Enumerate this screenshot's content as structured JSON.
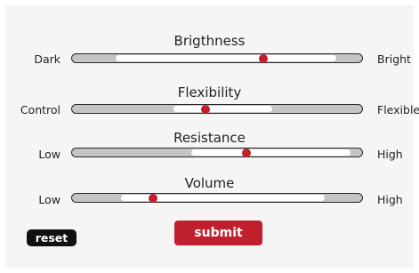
{
  "sliders": [
    {
      "title": "Brigthness",
      "left": "Dark",
      "right": "Bright",
      "range": [
        0.15,
        0.91
      ],
      "value": 0.66
    },
    {
      "title": "Flexibility",
      "left": "Control",
      "right": "Flexible",
      "range": [
        0.35,
        0.69
      ],
      "value": 0.46
    },
    {
      "title": "Resistance",
      "left": "Low",
      "right": "High",
      "range": [
        0.41,
        0.96
      ],
      "value": 0.6
    },
    {
      "title": "Volume",
      "left": "Low",
      "right": "High",
      "range": [
        0.17,
        0.87
      ],
      "value": 0.28
    }
  ],
  "buttons": {
    "reset_label": "reset",
    "submit_label": "submit"
  },
  "colors": {
    "accent": "#c0202e",
    "track": "#c4c4c4",
    "track_fill": "#ffffff",
    "reset_bg": "#111111",
    "panel": "#f5f5f5"
  }
}
